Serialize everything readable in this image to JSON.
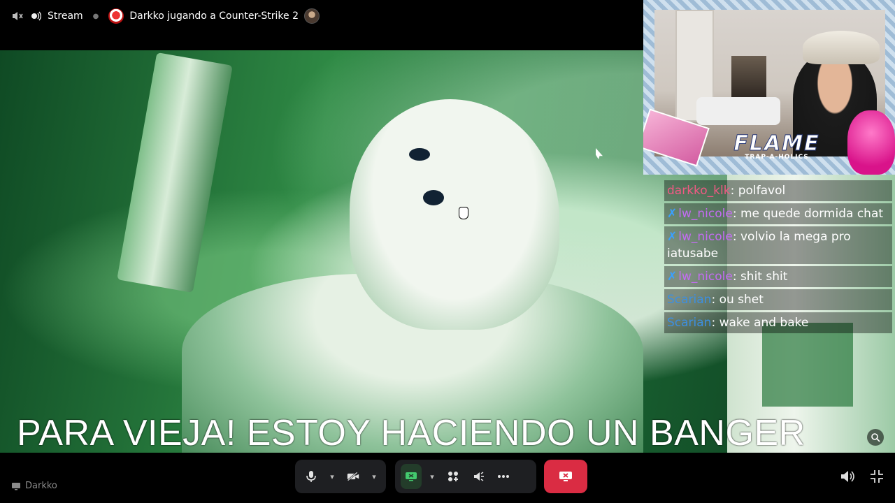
{
  "top_bar": {
    "stream_label": "Stream",
    "activity_title": "Darkko jugando a Counter-Strike 2"
  },
  "video": {
    "caption": "PARA VIEJA! ESTOY HACIENDO UN BANGER"
  },
  "overlay": {
    "brand_title": "FLAME",
    "brand_subtitle": "TRAP-A-HOLICS"
  },
  "chat": {
    "messages": [
      {
        "user": "darkko_klk",
        "text": ": polfavol",
        "color": "#f05a84",
        "badge": false
      },
      {
        "user": "lw_nicole",
        "text": ": me quede dormida chat",
        "color": "#c36cf2",
        "badge": true
      },
      {
        "user": "lw_nicole",
        "text": ": volvio la mega pro iatusabe",
        "color": "#c36cf2",
        "badge": true
      },
      {
        "user": "lw_nicole",
        "text": ": shit shit",
        "color": "#c36cf2",
        "badge": true
      },
      {
        "user": "Scarian",
        "text": ": ou shet",
        "color": "#3d8fe0",
        "badge": false
      },
      {
        "user": "Scarian",
        "text": ": wake and bake",
        "color": "#3d8fe0",
        "badge": false
      }
    ],
    "badge_glyph": "✗"
  },
  "bottom_bar": {
    "streamer_name": "Darkko"
  },
  "colors": {
    "leave_button": "#da2c43",
    "screen_share_active": "#43c96e",
    "control_bg": "#1e1f22"
  },
  "icons": {
    "volume": "volume-muted-icon",
    "stream": "broadcast-icon",
    "microphone": "microphone-icon",
    "camera": "camera-off-icon",
    "screen_share": "screen-share-icon",
    "activities": "activities-icon",
    "soundboard": "soundboard-icon",
    "more": "more-icon",
    "leave": "leave-call-icon",
    "speaker": "speaker-icon",
    "fullscreen_exit": "fullscreen-exit-icon",
    "zoom": "zoom-icon"
  }
}
